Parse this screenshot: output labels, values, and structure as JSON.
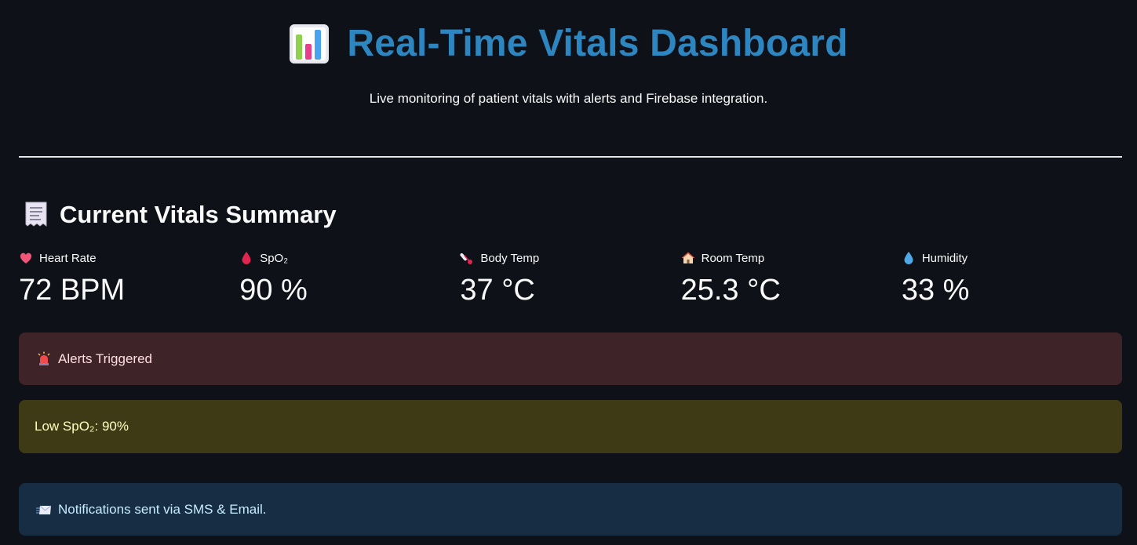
{
  "header": {
    "icon": "bar-chart-icon",
    "title": "Real-Time Vitals Dashboard",
    "subtitle": "Live monitoring of patient vitals with alerts and Firebase integration.",
    "title_color": "#2e86c1"
  },
  "summary": {
    "icon": "receipt-icon",
    "title": "Current Vitals Summary"
  },
  "metrics": [
    {
      "icon": "heart-icon",
      "label": "Heart Rate",
      "value": "72 BPM"
    },
    {
      "icon": "blood-drop-icon",
      "label": "SpO₂",
      "value": "90 %"
    },
    {
      "icon": "thermometer-icon",
      "label": "Body Temp",
      "value": "37 °C"
    },
    {
      "icon": "house-icon",
      "label": "Room Temp",
      "value": "25.3 °C"
    },
    {
      "icon": "water-drop-icon",
      "label": "Humidity",
      "value": "33 %"
    }
  ],
  "alerts": {
    "error": {
      "icon": "siren-icon",
      "text": "Alerts Triggered",
      "color": "#3e2328"
    },
    "warning": {
      "text": "Low SpO₂: 90%",
      "color": "#3e3a16"
    },
    "info": {
      "icon": "envelope-icon",
      "text": "Notifications sent via SMS & Email.",
      "color": "#172d43"
    }
  },
  "background": "#0e1117"
}
